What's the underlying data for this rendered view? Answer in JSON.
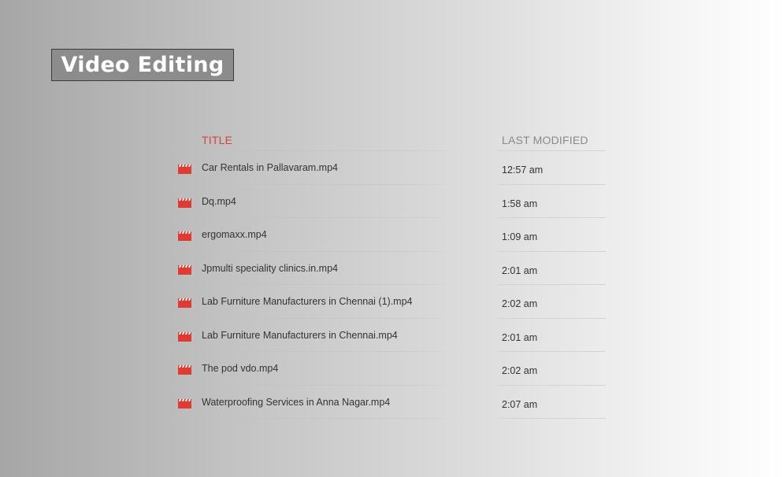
{
  "heading": "Video Editing",
  "table": {
    "col_title": "TITLE",
    "col_modified": "LAST MODIFIED",
    "rows": [
      {
        "name": "Car Rentals in Pallavaram.mp4",
        "modified": "12:57 am"
      },
      {
        "name": "Dq.mp4",
        "modified": "1:58 am"
      },
      {
        "name": "ergomaxx.mp4",
        "modified": "1:09 am"
      },
      {
        "name": "Jpmulti speciality clinics.in.mp4",
        "modified": "2:01 am"
      },
      {
        "name": "Lab Furniture Manufacturers in Chennai (1).mp4",
        "modified": "2:02 am"
      },
      {
        "name": "Lab Furniture Manufacturers in Chennai.mp4",
        "modified": "2:01 am"
      },
      {
        "name": "The pod vdo.mp4",
        "modified": "2:02 am"
      },
      {
        "name": "Waterproofing Services in Anna Nagar.mp4",
        "modified": "2:07 am"
      }
    ]
  },
  "icons": {
    "file": "video-clapperboard-icon"
  },
  "colors": {
    "accent": "#d8433a",
    "icon": "#e03b33"
  }
}
